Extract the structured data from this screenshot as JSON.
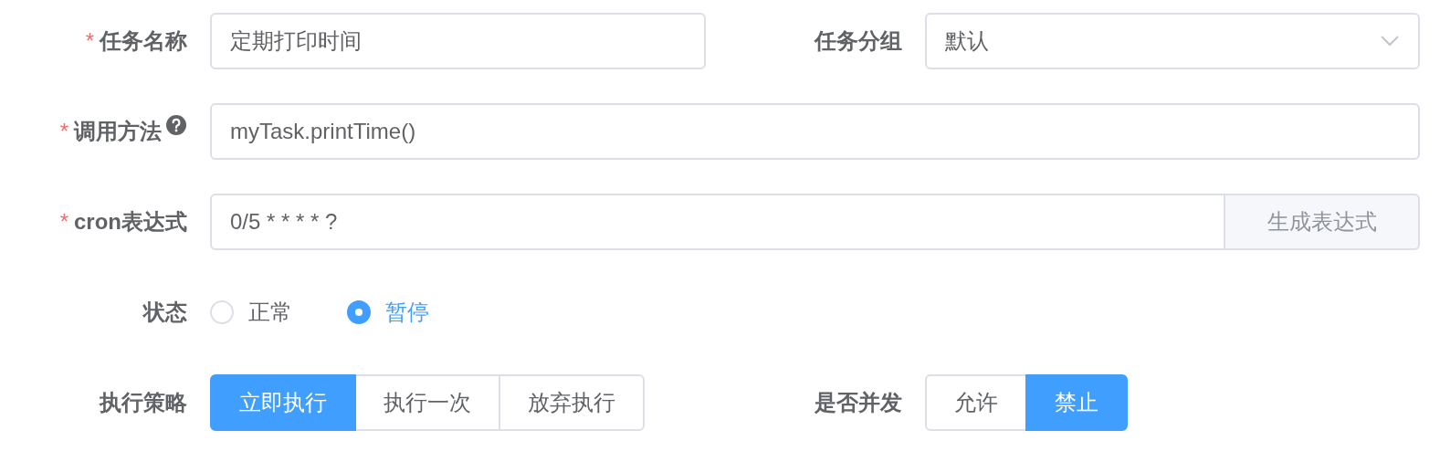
{
  "rows": [
    {
      "fields": [
        {
          "kind": "input",
          "label": "任务名称",
          "required_mark": "*",
          "value": "定期打印时间"
        },
        {
          "kind": "select",
          "label": "任务分组",
          "value": "默认"
        }
      ]
    },
    {
      "fields": [
        {
          "kind": "input",
          "label": "调用方法",
          "required_mark": "*",
          "help": true,
          "value": "myTask.printTime()"
        }
      ]
    },
    {
      "fields": [
        {
          "kind": "input_button",
          "label": "cron表达式",
          "required_mark": "*",
          "value": "0/5 * * * * ?",
          "button": "生成表达式"
        }
      ]
    },
    {
      "fields": [
        {
          "kind": "radio",
          "label": "状态",
          "options": [
            {
              "label": "正常",
              "selected": false
            },
            {
              "label": "暂停",
              "selected": true
            }
          ]
        }
      ]
    },
    {
      "fields": [
        {
          "kind": "segmented",
          "label": "执行策略",
          "options": [
            {
              "label": "立即执行",
              "selected": true
            },
            {
              "label": "执行一次",
              "selected": false
            },
            {
              "label": "放弃执行",
              "selected": false
            }
          ]
        },
        {
          "kind": "segmented",
          "label": "是否并发",
          "options": [
            {
              "label": "允许",
              "selected": false
            },
            {
              "label": "禁止",
              "selected": true
            }
          ]
        }
      ]
    }
  ]
}
